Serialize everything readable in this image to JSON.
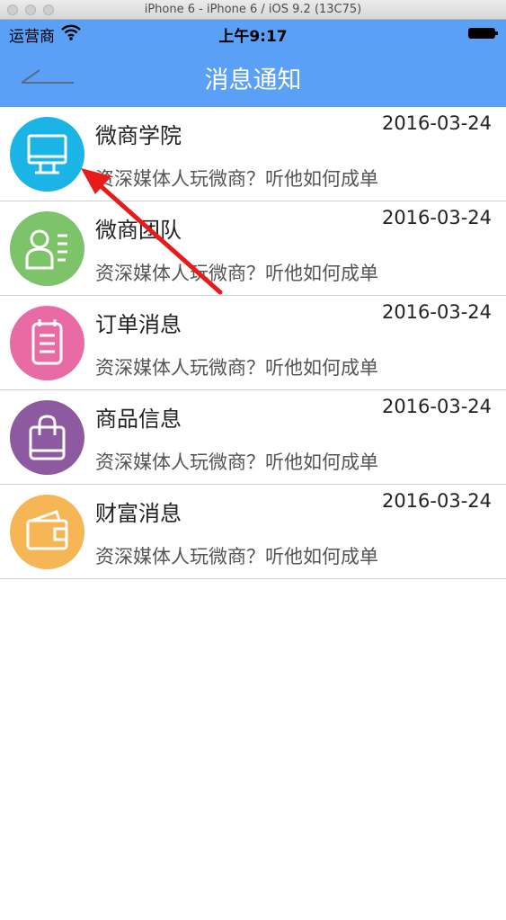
{
  "window": {
    "title": "iPhone 6 - iPhone 6 / iOS 9.2 (13C75)"
  },
  "status_bar": {
    "carrier": "运营商",
    "time": "上午9:17"
  },
  "nav": {
    "title": "消息通知",
    "back_icon": "back-arrow-icon"
  },
  "messages": [
    {
      "title": "微商学院",
      "date": "2016-03-24",
      "preview": "资深媒体人玩微商？听他如何成单",
      "icon": "monitor-icon",
      "color": "#1ab4e6"
    },
    {
      "title": "微商团队",
      "date": "2016-03-24",
      "preview": "资深媒体人玩微商？听他如何成单",
      "icon": "team-contact-icon",
      "color": "#7cc369"
    },
    {
      "title": "订单消息",
      "date": "2016-03-24",
      "preview": "资深媒体人玩微商？听他如何成单",
      "icon": "order-list-icon",
      "color": "#e86ba4"
    },
    {
      "title": "商品信息",
      "date": "2016-03-24",
      "preview": "资深媒体人玩微商？听他如何成单",
      "icon": "shopping-bag-icon",
      "color": "#8d5aa1"
    },
    {
      "title": "财富消息",
      "date": "2016-03-24",
      "preview": "资深媒体人玩微商？听他如何成单",
      "icon": "wallet-icon",
      "color": "#f6b656"
    }
  ],
  "annotation": {
    "icon": "red-arrow-annotation",
    "color": "#e81b1b"
  }
}
